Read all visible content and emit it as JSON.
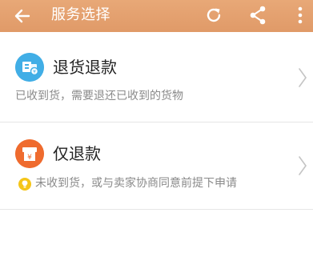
{
  "header": {
    "title": "服务选择",
    "back_icon": "arrow-left-icon",
    "refresh_icon": "refresh-icon",
    "share_icon": "share-icon",
    "more_icon": "more-vertical-icon",
    "background": "#e39f6e"
  },
  "options": [
    {
      "title": "退货退款",
      "description": "已收到货，需要退还已收到的货物",
      "icon": "return-goods-icon",
      "icon_color": "#41aee6"
    },
    {
      "title": "仅退款",
      "description": "未收到货，或与卖家协商同意前提下申请",
      "icon": "refund-only-icon",
      "icon_color": "#ef6b2e",
      "tip_icon": "lightbulb-icon"
    }
  ]
}
